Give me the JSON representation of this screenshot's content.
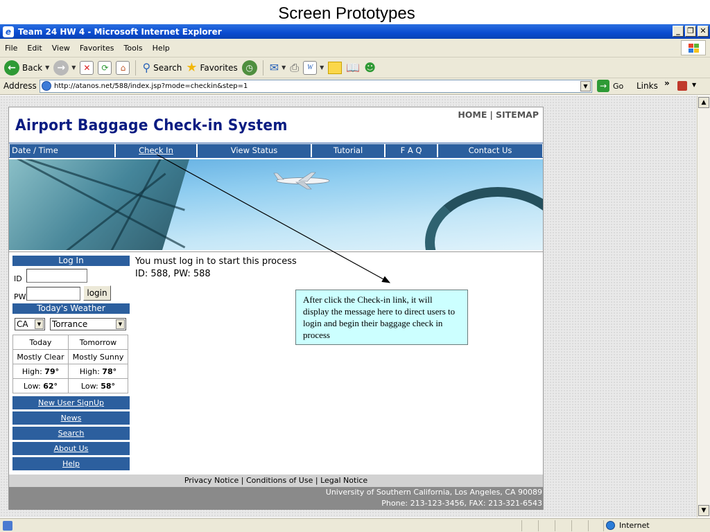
{
  "slide": {
    "title": "Screen Prototypes"
  },
  "window": {
    "title": "Team 24 HW 4 - Microsoft Internet Explorer"
  },
  "menu": [
    "File",
    "Edit",
    "View",
    "Favorites",
    "Tools",
    "Help"
  ],
  "toolbar": {
    "back": "Back",
    "search": "Search",
    "favorites": "Favorites"
  },
  "address": {
    "label": "Address",
    "url": "http://atanos.net/588/index.jsp?mode=checkin&step=1",
    "go": "Go",
    "links": "Links",
    "more": "»"
  },
  "site": {
    "title": "Airport Baggage Check-in System",
    "top_links": {
      "home": "HOME",
      "sitemap": "SITEMAP"
    },
    "nav": [
      "Date / Time",
      "Check In",
      "View Status",
      "Tutorial",
      "F A Q",
      "Contact Us"
    ],
    "login": {
      "header": "Log In",
      "id_label": "ID",
      "pw_label": "PW",
      "button": "login"
    },
    "weather": {
      "header": "Today's Weather",
      "state": "CA",
      "city": "Torrance",
      "rows": [
        [
          "Today",
          "Tomorrow"
        ],
        [
          "Mostly Clear",
          "Mostly Sunny"
        ],
        [
          "High: ",
          "79°",
          "High: ",
          "78°"
        ],
        [
          "Low: ",
          "62°",
          "Low: ",
          "58°"
        ]
      ]
    },
    "side_links": [
      "New User SignUp",
      "News",
      "Search",
      "About Us",
      "Help"
    ],
    "message": {
      "line1": "You must log in to start this process",
      "line2": "ID: 588, PW: 588"
    },
    "footer": {
      "privacy": "Privacy Notice",
      "conditions": "Conditions of Use",
      "legal": "Legal Notice",
      "address": "University of Southern California, Los Angeles, CA 90089",
      "phone": "Phone: 213-123-3456, FAX: 213-321-6543"
    }
  },
  "callout": "After click the Check-in link, it will display the message here to direct users to login and begin their baggage check in process",
  "status": {
    "zone": "Internet"
  },
  "colors": {
    "nav_blue": "#2c5f9e",
    "title_navy": "#0a1c82",
    "callout_bg": "#ccffff",
    "titlebar_blue": "#0a4bd0"
  }
}
